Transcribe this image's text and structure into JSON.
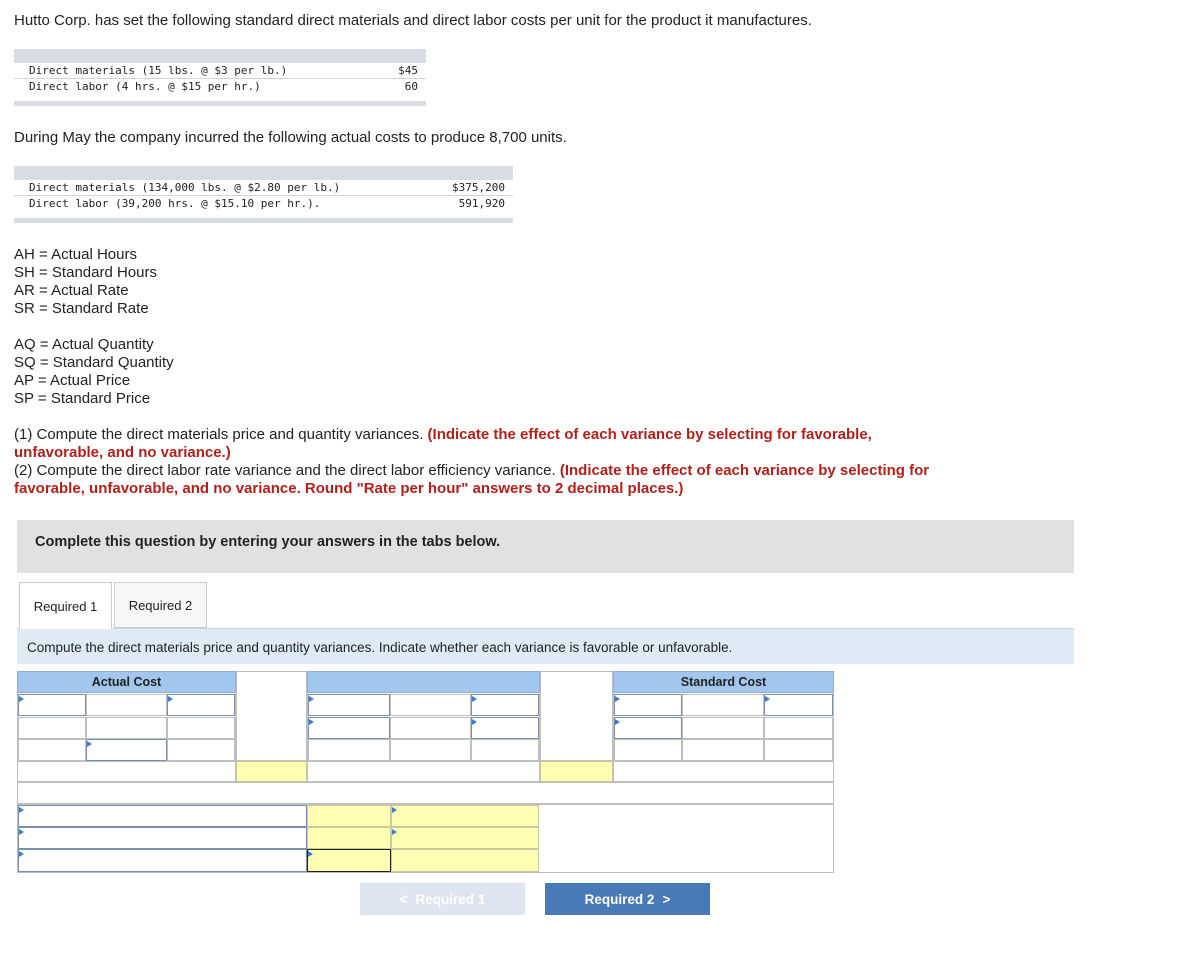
{
  "intro": "Hutto Corp. has set the following standard direct materials and direct labor costs per unit for the product it manufactures.",
  "standard_table": [
    {
      "label": "Direct materials (15 lbs. @ $3 per lb.)",
      "amount": "$45"
    },
    {
      "label": "Direct labor (4 hrs. @ $15 per hr.)",
      "amount": "60"
    }
  ],
  "actual_intro": "During May the company incurred the following actual costs to produce 8,700 units.",
  "actual_table": [
    {
      "label": "Direct materials (134,000 lbs. @ $2.80 per lb.)",
      "amount": "$375,200"
    },
    {
      "label": "Direct labor (39,200 hrs. @ $15.10 per hr.).",
      "amount": "591,920"
    }
  ],
  "defs_labor": [
    "AH = Actual Hours",
    "SH = Standard Hours",
    "AR = Actual Rate",
    "SR = Standard Rate"
  ],
  "defs_materials": [
    "AQ = Actual Quantity",
    "SQ = Standard Quantity",
    "AP = Actual Price",
    "SP = Standard Price"
  ],
  "instructions": {
    "q1": "(1) Compute the direct materials price and quantity variances.",
    "q1_red": "(Indicate the effect of each variance by selecting for favorable, unfavorable, and no variance.)",
    "q2": "(2) Compute the direct labor rate variance and the direct labor efficiency variance.",
    "q2_red": "(Indicate the effect of each variance by selecting for favorable, unfavorable, and no variance. Round \"Rate per hour\" answers to 2 decimal places.)"
  },
  "complete_prompt": "Complete this question by entering your answers in the tabs below.",
  "tabs": [
    {
      "label": "Required 1"
    },
    {
      "label": "Required 2"
    }
  ],
  "task_text": "Compute the direct materials price and quantity variances. Indicate whether each variance is favorable or unfavorable.",
  "grid": {
    "actual_cost_header": "Actual Cost",
    "standard_cost_header": "Standard Cost"
  },
  "nav": {
    "prev_label": "Required 1",
    "next_label": "Required 2"
  },
  "colors": {
    "header_blue": "#a3c6ef",
    "highlight_yellow": "#ffffb3",
    "accent_red": "#b0211b",
    "button_blue": "#4a79b7"
  }
}
